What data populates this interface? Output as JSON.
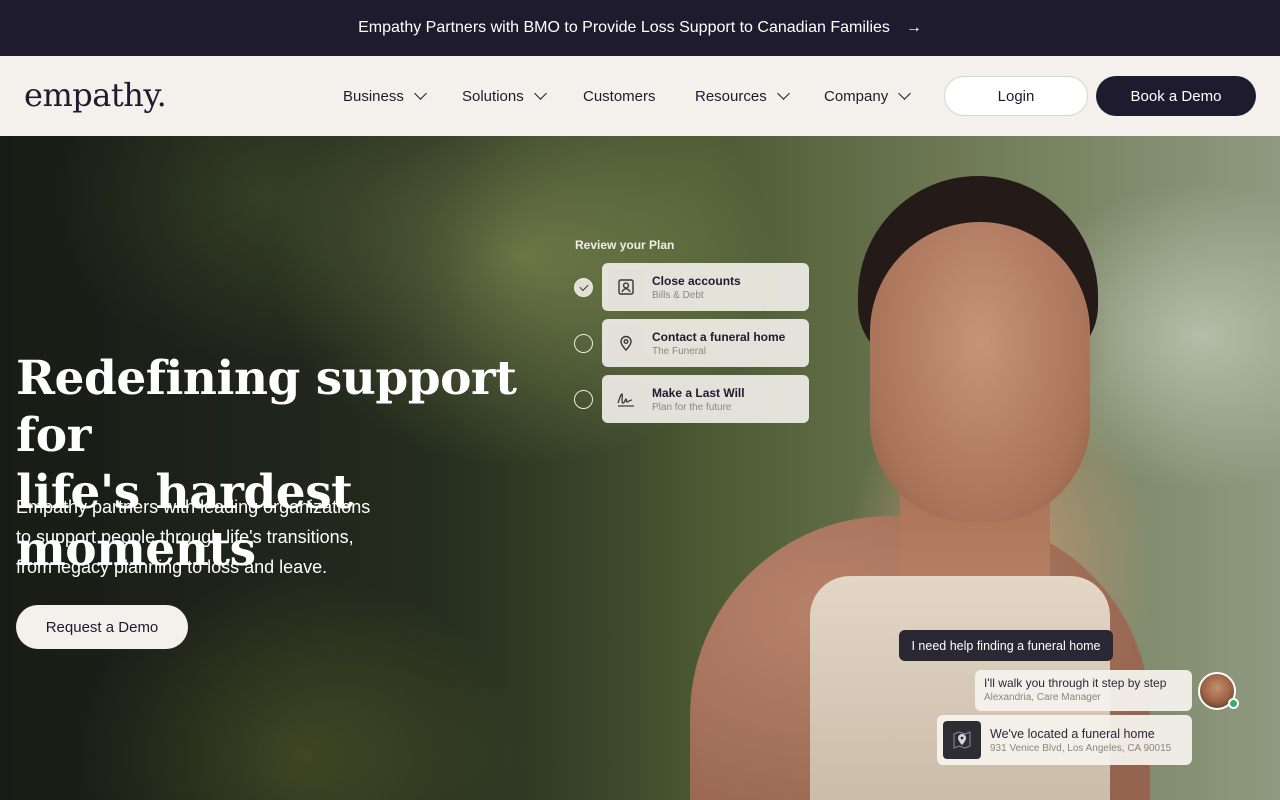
{
  "announcement": {
    "text": "Empathy Partners with BMO to Provide Loss Support to Canadian Families",
    "arrow_icon": "arrow-right-icon"
  },
  "nav": {
    "logo": "empathy.",
    "items": [
      {
        "label": "Business",
        "dropdown": true
      },
      {
        "label": "Solutions",
        "dropdown": true
      },
      {
        "label": "Customers",
        "dropdown": false
      },
      {
        "label": "Resources",
        "dropdown": true
      },
      {
        "label": "Company",
        "dropdown": true
      }
    ],
    "login_label": "Login",
    "demo_label": "Book a Demo"
  },
  "hero": {
    "title_line1": "Redefining support for",
    "title_line2": "life's hardest moments",
    "subtitle_line1": "Empathy partners with leading organizations",
    "subtitle_line2": "to support people through life's transitions,",
    "subtitle_line3": "from legacy planning to loss and leave.",
    "cta_label": "Request a Demo"
  },
  "plan": {
    "label": "Review your Plan",
    "items": [
      {
        "title": "Close accounts",
        "subtitle": "Bills & Debt",
        "done": true,
        "icon": "account-icon"
      },
      {
        "title": "Contact a funeral home",
        "subtitle": "The Funeral",
        "done": false,
        "icon": "location-pin-icon"
      },
      {
        "title": "Make a Last Will",
        "subtitle": "Plan for the future",
        "done": false,
        "icon": "signature-icon"
      }
    ]
  },
  "chat": {
    "question": "I need help finding a funeral home",
    "answer": "I'll walk you through it step by step",
    "answer_author": "Alexandria, Care Manager",
    "location_title": "We've located a funeral home",
    "location_address": "931 Venice Blvd, Los Angeles, CA 90015"
  },
  "colors": {
    "navy": "#1e1b2e",
    "cream": "#f4f0eb",
    "online": "#2fb36b"
  }
}
